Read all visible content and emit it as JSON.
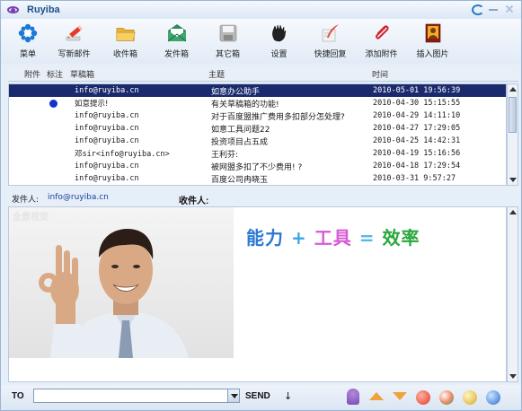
{
  "app": {
    "title": "Ruyiba"
  },
  "toolbar": [
    {
      "id": "menu",
      "label": "菜单",
      "icon": "snowflake-menu-icon"
    },
    {
      "id": "compose",
      "label": "写新邮件",
      "icon": "pencil-icon"
    },
    {
      "id": "inbox",
      "label": "收件箱",
      "icon": "folder-icon"
    },
    {
      "id": "outbox",
      "label": "发件箱",
      "icon": "envelope-icon"
    },
    {
      "id": "other",
      "label": "其它箱",
      "icon": "disk-icon"
    },
    {
      "id": "settings",
      "label": "设置",
      "icon": "hand-icon"
    },
    {
      "id": "quick_reply",
      "label": "快捷回复",
      "icon": "quill-icon"
    },
    {
      "id": "attach",
      "label": "添加附件",
      "icon": "paperclip-icon"
    },
    {
      "id": "insert_image",
      "label": "插入图片",
      "icon": "picture-icon"
    }
  ],
  "list": {
    "headers": {
      "attach": "附件",
      "flag": "标注",
      "drafts": "草稿箱",
      "subject": "主题",
      "time": "时间"
    },
    "rows": [
      {
        "from": "info@ruyiba.cn",
        "subject": "如意办公助手",
        "time": "2010-05-01 19:56:39",
        "flag": false,
        "selected": true
      },
      {
        "from": "如意提示!",
        "subject": "有关草稿箱的功能!",
        "time": "2010-04-30 15:15:55",
        "flag": true,
        "selected": false
      },
      {
        "from": "info@ruyiba.cn",
        "subject": "对于百度盟推广费用多扣部分怎处理?",
        "time": "2010-04-29 14:11:10",
        "flag": false,
        "selected": false
      },
      {
        "from": "info@ruyiba.cn",
        "subject": "如意工具问题22",
        "time": "2010-04-27 17:29:05",
        "flag": false,
        "selected": false
      },
      {
        "from": "info@ruyiba.cn",
        "subject": "投资项目占五成",
        "time": "2010-04-25 14:42:31",
        "flag": false,
        "selected": false
      },
      {
        "from": "邓sir<info@ruyiba.cn>",
        "subject": "王利芬:",
        "time": "2010-04-19 15:16:56",
        "flag": false,
        "selected": false
      },
      {
        "from": "info@ruyiba.cn",
        "subject": "被网盟多扣了不少费用! ?",
        "time": "2010-04-18 17:29:54",
        "flag": false,
        "selected": false
      },
      {
        "from": "info@ruyiba.cn",
        "subject": "百度公司冉晓玉",
        "time": "2010-03-31 9:57:27",
        "flag": false,
        "selected": false
      }
    ]
  },
  "meta": {
    "from_label": "发件人:",
    "from_value": "info@ruyiba.cn",
    "to_label": "收件人:"
  },
  "preview": {
    "watermark": "全景视觉",
    "slogan": {
      "a": "能力",
      "op1": "+",
      "b": "工具",
      "op2": "=",
      "c": "效率"
    }
  },
  "bottom": {
    "to_label": "TO",
    "to_value": "",
    "send_label": "SEND",
    "send_arrow": "↓"
  }
}
